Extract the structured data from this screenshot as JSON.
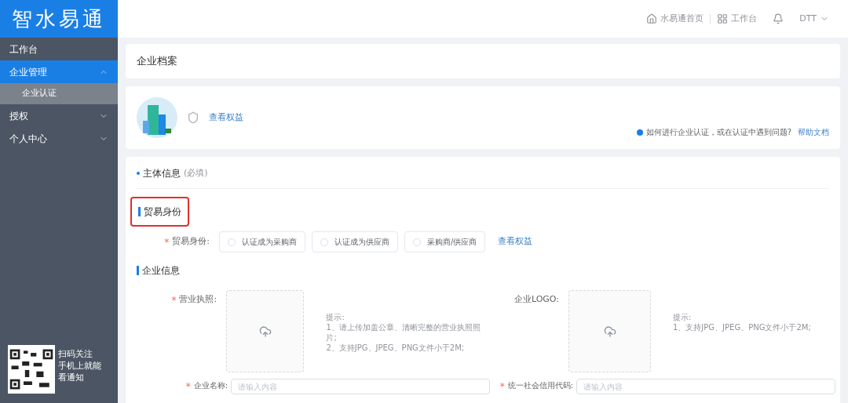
{
  "logo": {
    "text": "智水易通"
  },
  "sidebar": {
    "items": [
      {
        "label": "工作台",
        "selected": false
      },
      {
        "label": "企业管理",
        "selected": true,
        "expanded": true,
        "children": [
          {
            "label": "企业认证",
            "selected": true
          }
        ]
      },
      {
        "label": "授权",
        "selected": false,
        "expanded": false
      },
      {
        "label": "个人中心",
        "selected": false,
        "expanded": false
      }
    ],
    "qr_caption": [
      "扫码关注",
      "手机上就能",
      "看通知"
    ]
  },
  "header": {
    "links": [
      "水易通首页",
      "工作台"
    ],
    "user": "DTT"
  },
  "page_title": "企业档案",
  "profile": {
    "link": "查看权益",
    "help_text": "如何进行企业认证，或在认证中遇到问题?",
    "help_link": "帮助文档"
  },
  "form": {
    "section_title": "主体信息",
    "section_note": "(必填)",
    "trade": {
      "heading": "贸易身份",
      "highlighted": true,
      "label": "贸易身份:",
      "mark": "*",
      "options": [
        {
          "label": "认证成为采购商",
          "selected": false
        },
        {
          "label": "认证成为供应商",
          "selected": false
        },
        {
          "label": "采购商/供应商",
          "selected": false
        }
      ],
      "link": "查看权益"
    },
    "company": {
      "heading": "企业信息",
      "uploads": [
        {
          "label": "营业执照:",
          "mark": "*",
          "hint": [
            "提示:",
            "1、请上传加盖公章、清晰完整的营业执照照片;",
            "2、支持JPG、JPEG、PNG文件小于2M;"
          ]
        },
        {
          "label": "企业LOGO:",
          "hint": [
            "提示:",
            "1、支持JPG、JPEG、PNG文件小于2M;"
          ]
        }
      ],
      "fields": [
        {
          "label": "企业名称:",
          "mark": "*",
          "placeholder": "请输入内容"
        },
        {
          "label": "统一社会信用代码:",
          "mark": "*",
          "placeholder": "请输入内容"
        }
      ]
    }
  }
}
